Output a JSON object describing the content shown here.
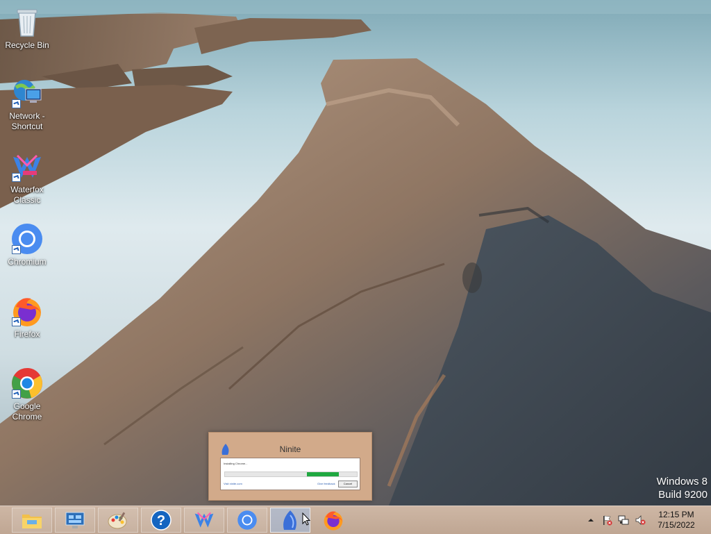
{
  "desktop": {
    "icons": [
      {
        "label": "Recycle Bin",
        "icon": "recycle-bin-icon"
      },
      {
        "label": "Network -\nShortcut",
        "icon": "network-icon"
      },
      {
        "label": "Waterfox\nClassic",
        "icon": "waterfox-icon"
      },
      {
        "label": "Chromium",
        "icon": "chromium-icon"
      },
      {
        "label": "Firefox",
        "icon": "firefox-icon"
      },
      {
        "label": "Google\nChrome",
        "icon": "chrome-icon"
      }
    ]
  },
  "ninite": {
    "title": "Ninite",
    "status": "Installing Chrome...",
    "progress": 0.24,
    "link_left": "Visit ninite.com",
    "link_right": "Give feedback",
    "cancel_label": "Cancel"
  },
  "watermark": {
    "line1": "Windows 8",
    "line2": "Build 9200"
  },
  "taskbar": {
    "buttons": [
      {
        "name": "file-explorer",
        "icon": "folder-icon"
      },
      {
        "name": "control-panel",
        "icon": "control-panel-icon"
      },
      {
        "name": "paint",
        "icon": "paint-palette-icon"
      },
      {
        "name": "help",
        "icon": "help-icon"
      },
      {
        "name": "waterfox",
        "icon": "waterfox-icon"
      },
      {
        "name": "chromium",
        "icon": "chromium-icon"
      },
      {
        "name": "ninite",
        "icon": "ninite-icon",
        "active": true
      },
      {
        "name": "firefox",
        "icon": "firefox-icon"
      }
    ],
    "tray": {
      "icons": [
        "show-hidden-icons-chevron",
        "action-center-flag-icon",
        "network-status-icon",
        "volume-muted-icon"
      ]
    },
    "clock": {
      "time": "12:15 PM",
      "date": "7/15/2022"
    }
  },
  "colors": {
    "taskbar": "#c9a98e",
    "ninite_frame": "#d2aa8a",
    "progress_green": "#1fa840"
  }
}
